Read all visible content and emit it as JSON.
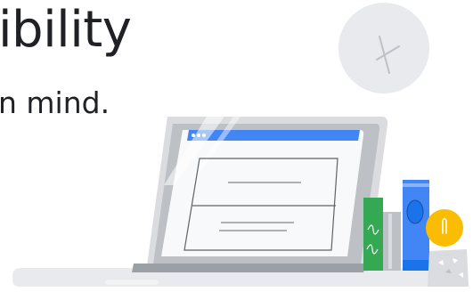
{
  "hero": {
    "heading": "ibility",
    "subheading": "n mind."
  },
  "illustration": {
    "colors": {
      "laptop_body": "#dadce0",
      "laptop_screen_border": "#9aa0a6",
      "browser_bar": "#4285f4",
      "book_green": "#34a853",
      "book_blue": "#4285f4",
      "book_gray": "#bdc1c6",
      "bulb_yellow": "#fbbc04",
      "shadow": "#e8eaed"
    },
    "icons": [
      "clock-icon",
      "laptop-icon",
      "document-icon",
      "book-icon",
      "lightbulb-icon",
      "pencil-cup-icon"
    ]
  }
}
